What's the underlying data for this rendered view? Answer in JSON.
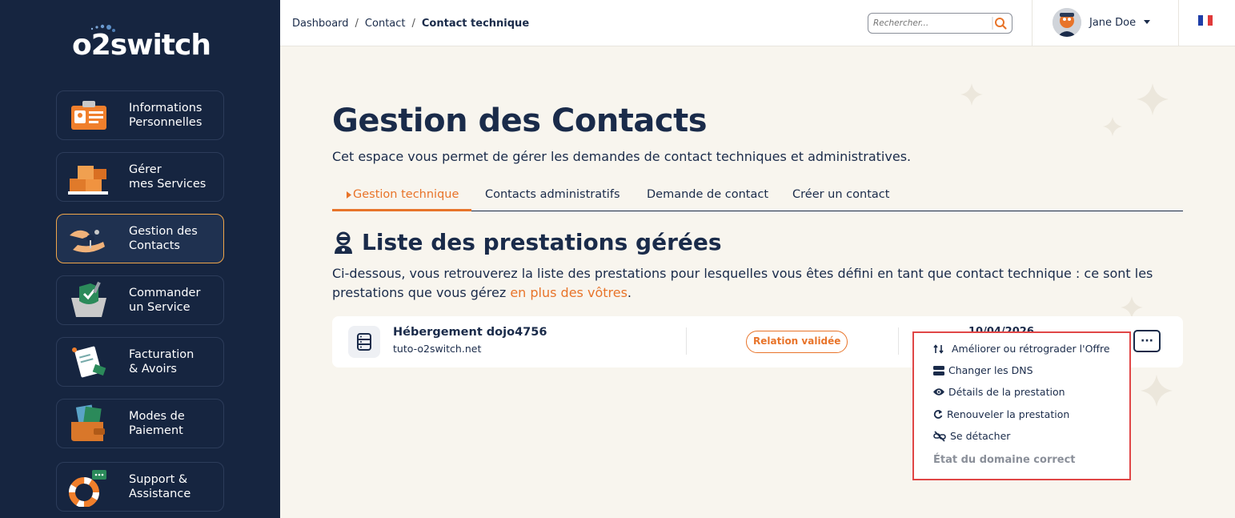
{
  "brand": {
    "name": "o2switch"
  },
  "sidebar": {
    "items": [
      {
        "label": "Informations\nPersonnelles",
        "icon": "id-card-icon"
      },
      {
        "label": "Gérer\nmes Services",
        "icon": "boxes-icon"
      },
      {
        "label": "Gestion des\nContacts",
        "icon": "handshake-keys-icon",
        "active": true
      },
      {
        "label": "Commander\nun Service",
        "icon": "shopping-basket-icon"
      },
      {
        "label": "Facturation\n& Avoirs",
        "icon": "invoice-icon"
      },
      {
        "label": "Modes de\nPaiement",
        "icon": "wallet-icon"
      },
      {
        "label": "Support &\nAssistance",
        "icon": "lifebuoy-icon"
      }
    ]
  },
  "topbar": {
    "breadcrumb": [
      "Dashboard",
      "Contact",
      "Contact technique"
    ],
    "search_placeholder": "Rechercher...",
    "user_name": "Jane Doe",
    "language": "fr"
  },
  "main": {
    "title": "Gestion des Contacts",
    "description": "Cet espace vous permet de gérer les demandes de contact techniques et administratives.",
    "tabs": [
      {
        "label": "Gestion technique",
        "active": true
      },
      {
        "label": "Contacts administratifs"
      },
      {
        "label": "Demande de contact"
      },
      {
        "label": "Créer un contact"
      }
    ],
    "section_title": "Liste des prestations gérées",
    "section_desc_1": "Ci-dessous, vous retrouverez la liste des prestations pour lesquelles vous êtes défini en tant que contact technique : ce sont les prestations que vous gérez ",
    "section_desc_link": "en plus des vôtres",
    "section_desc_end": "."
  },
  "service": {
    "name": "Hébergement dojo4756",
    "domain": "tuto-o2switch.net",
    "status": "Relation validée",
    "date_partial": "10/04/2026",
    "more_label": "···"
  },
  "dropdown": {
    "items": [
      {
        "label": "Améliorer ou rétrograder l'Offre",
        "icon": "arrows-swap-icon"
      },
      {
        "label": "Changer les DNS",
        "icon": "server-icon"
      },
      {
        "label": "Détails de la prestation",
        "icon": "eye-icon"
      },
      {
        "label": "Renouveler la prestation",
        "icon": "refresh-icon"
      },
      {
        "label": "Se détacher",
        "icon": "unlink-icon"
      }
    ],
    "status": "État du domaine correct"
  },
  "colors": {
    "sidebar": "#162540",
    "accent": "#e8742a",
    "highlight_border": "#e04646"
  }
}
